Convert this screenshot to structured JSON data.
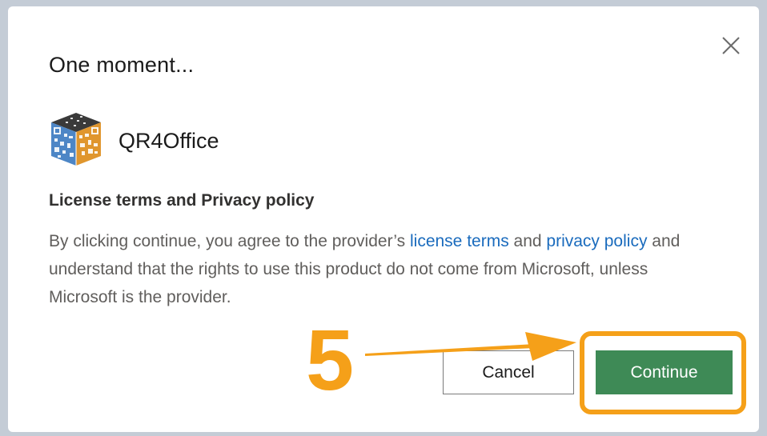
{
  "dialog": {
    "title": "One moment...",
    "close_icon": "close-icon",
    "app": {
      "name": "QR4Office",
      "logo_icon": "qr-code-cube-logo"
    },
    "section_heading": "License terms and Privacy policy",
    "body": {
      "text_before": "By clicking continue, you agree to the provider’s ",
      "license_link": "license terms",
      "text_middle": " and ",
      "privacy_link": "privacy policy",
      "text_after": " and understand that the rights to use this product do not come from Microsoft, unless Microsoft is the provider."
    },
    "buttons": {
      "cancel": "Cancel",
      "continue": "Continue"
    }
  },
  "annotation": {
    "step_number": "5",
    "arrow_icon": "arrow-right-icon",
    "color": "#f5a019"
  },
  "colors": {
    "continue_button": "#3e8a56",
    "link": "#1a6bbd",
    "backdrop": "#c4ccd6"
  }
}
